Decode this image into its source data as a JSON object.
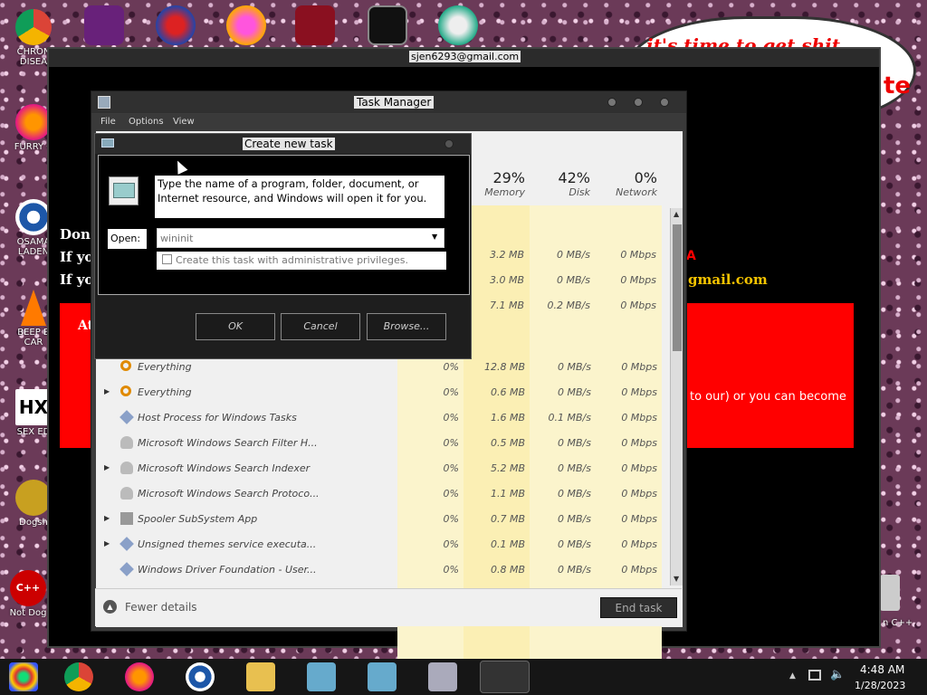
{
  "desktop": {
    "icons": [
      {
        "label": "CHRON DISEA"
      },
      {
        "label": "FURRY C"
      },
      {
        "label": "OSAMA LADEN"
      },
      {
        "label": "BEEP B CAR"
      },
      {
        "label": "SEX ED"
      },
      {
        "label": "Dogsh"
      },
      {
        "label": "Not Dog"
      }
    ],
    "right_icon_label": "n C++",
    "cloud_text": "it's time to get shit",
    "cloud_text2": "te"
  },
  "ransom_window": {
    "title": "sjen6293@gmail.com",
    "lines": [
      "Don'",
      "If yo",
      "If yo"
    ],
    "red_text_l": "At",
    "right_text_a": "A",
    "right_text_email": "gmail.com",
    "right_text_body": "to our) or you can become"
  },
  "task_manager": {
    "title": "Task Manager",
    "menu": [
      "File",
      "Options",
      "View"
    ],
    "columns": [
      {
        "pct": "29%",
        "label": "Memory"
      },
      {
        "pct": "42%",
        "label": "Disk"
      },
      {
        "pct": "0%",
        "label": "Network"
      }
    ],
    "top_rows": [
      {
        "mem": "3.2 MB",
        "disk": "0 MB/s",
        "net": "0 Mbps"
      },
      {
        "mem": "3.0 MB",
        "disk": "0 MB/s",
        "net": "0 Mbps"
      },
      {
        "mem": "7.1 MB",
        "disk": "0.2 MB/s",
        "net": "0 Mbps"
      }
    ],
    "rows": [
      {
        "name": "Everything",
        "cpu": "0%",
        "mem": "12.8 MB",
        "disk": "0 MB/s",
        "net": "0 Mbps",
        "expand": ""
      },
      {
        "name": "Everything",
        "cpu": "0%",
        "mem": "0.6 MB",
        "disk": "0 MB/s",
        "net": "0 Mbps",
        "expand": "▶"
      },
      {
        "name": "Host Process for Windows Tasks",
        "cpu": "0%",
        "mem": "1.6 MB",
        "disk": "0.1 MB/s",
        "net": "0 Mbps",
        "expand": ""
      },
      {
        "name": "Microsoft Windows Search Filter H...",
        "cpu": "0%",
        "mem": "0.5 MB",
        "disk": "0 MB/s",
        "net": "0 Mbps",
        "expand": ""
      },
      {
        "name": "Microsoft Windows Search Indexer",
        "cpu": "0%",
        "mem": "5.2 MB",
        "disk": "0 MB/s",
        "net": "0 Mbps",
        "expand": "▶"
      },
      {
        "name": "Microsoft Windows Search Protoco...",
        "cpu": "0%",
        "mem": "1.1 MB",
        "disk": "0 MB/s",
        "net": "0 Mbps",
        "expand": ""
      },
      {
        "name": "Spooler SubSystem App",
        "cpu": "0%",
        "mem": "0.7 MB",
        "disk": "0 MB/s",
        "net": "0 Mbps",
        "expand": "▶"
      },
      {
        "name": "Unsigned themes service executa...",
        "cpu": "0%",
        "mem": "0.1 MB",
        "disk": "0 MB/s",
        "net": "0 Mbps",
        "expand": "▶"
      },
      {
        "name": "Windows Driver Foundation - User...",
        "cpu": "0%",
        "mem": "0.8 MB",
        "disk": "0 MB/s",
        "net": "0 Mbps",
        "expand": ""
      }
    ],
    "fewer_details": "Fewer details",
    "end_task": "End task"
  },
  "run_dialog": {
    "title": "Create new task",
    "description": "Type the name of a program, folder, document, or Internet resource, and Windows will open it for you.",
    "open_label": "Open:",
    "open_value": "wininit",
    "admin_checkbox_label": "Create this task with administrative privileges.",
    "admin_checked": false,
    "ok": "OK",
    "cancel": "Cancel",
    "browse": "Browse..."
  },
  "taskbar": {
    "time": "4:48 AM",
    "date": "1/28/2023"
  }
}
